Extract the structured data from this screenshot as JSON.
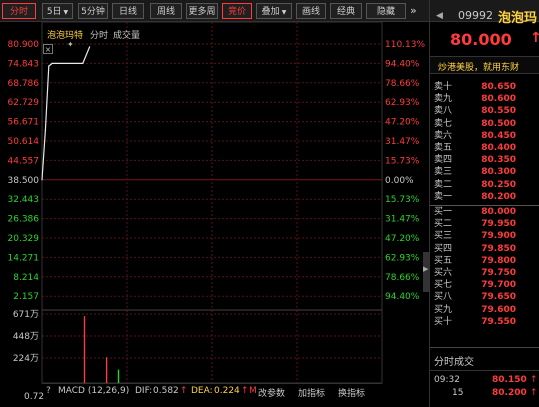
{
  "toolbar": {
    "items": [
      {
        "label": "分时",
        "active": true,
        "has_caret": false
      },
      {
        "label": "5日",
        "active": false,
        "has_caret": true
      },
      {
        "label": "5分钟",
        "active": false,
        "has_caret": false
      },
      {
        "label": "日线",
        "active": false,
        "has_caret": false
      },
      {
        "label": "周线",
        "active": false,
        "has_caret": false
      },
      {
        "label": "更多周",
        "active": false,
        "has_caret": false
      },
      {
        "label": "竞价",
        "active": true,
        "has_caret": false
      },
      {
        "label": "叠加",
        "active": false,
        "has_caret": true
      },
      {
        "label": "画线",
        "active": false,
        "has_caret": false
      },
      {
        "label": "经典",
        "active": false,
        "has_caret": false
      },
      {
        "label": "隐藏",
        "active": false,
        "has_caret": false
      }
    ],
    "more_glyph": "»"
  },
  "stock": {
    "back_glyph": "◀",
    "code": "09992",
    "name": "泡泡玛",
    "price": "80.000",
    "banner": "炒港美股，就用东财"
  },
  "chart_data": {
    "type": "line",
    "title": "泡泡玛特",
    "tabs": [
      "分时",
      "成交量"
    ],
    "y_left_ticks": [
      "80.900",
      "74.843",
      "68.786",
      "62.729",
      "56.671",
      "50.614",
      "44.557",
      "38.500",
      "32.443",
      "26.386",
      "20.329",
      "14.271",
      "8.214",
      "2.157"
    ],
    "y_right_ticks": [
      "110.13%",
      "94.40%",
      "78.66%",
      "62.93%",
      "47.20%",
      "31.47%",
      "15.73%",
      "0.00%",
      "15.73%",
      "31.47%",
      "47.20%",
      "62.93%",
      "78.66%",
      "94.40%"
    ],
    "prev_close": 38.5,
    "ylim": [
      2.157,
      80.9
    ],
    "price_series": [
      {
        "t": 0.0,
        "price": 38.5
      },
      {
        "t": 0.01,
        "price": 54.0
      },
      {
        "t": 0.02,
        "price": 74.0
      },
      {
        "t": 0.03,
        "price": 74.843
      },
      {
        "t": 0.12,
        "price": 74.843
      },
      {
        "t": 0.14,
        "price": 80.0
      }
    ],
    "volume_ticks": [
      "671万",
      "448万",
      "224万"
    ],
    "volume_bars": [
      {
        "t": 0.125,
        "value": 650,
        "color": "#ff3b3b"
      },
      {
        "t": 0.19,
        "value": 250,
        "color": "#ff3b3b"
      },
      {
        "t": 0.225,
        "value": 130,
        "color": "#2ad52a"
      }
    ],
    "volume_max": 671,
    "indicator": {
      "name": "MACD (12,26,9)",
      "dif_label": "DIF:",
      "dif": "0.582",
      "dif_arrow": "↑",
      "dea_label": "DEA:",
      "dea": "0.224",
      "dea_arrow": "↑",
      "m_label": "M",
      "params_label": "改参数",
      "add_label": "加指标",
      "switch_label": "换指标"
    },
    "macd_tick": "0.72",
    "colors": {
      "up": "#ff3b3b",
      "down": "#2ad52a",
      "flat": "#c8c8c8",
      "price_line": "#e8e8e8",
      "grid": "#5a1212"
    }
  },
  "order_book": {
    "asks": [
      {
        "label": "卖十",
        "price": "80.650"
      },
      {
        "label": "卖九",
        "price": "80.600"
      },
      {
        "label": "卖八",
        "price": "80.550"
      },
      {
        "label": "卖七",
        "price": "80.500"
      },
      {
        "label": "卖六",
        "price": "80.450"
      },
      {
        "label": "卖五",
        "price": "80.400"
      },
      {
        "label": "卖四",
        "price": "80.350"
      },
      {
        "label": "卖三",
        "price": "80.300"
      },
      {
        "label": "卖二",
        "price": "80.250"
      },
      {
        "label": "卖一",
        "price": "80.200"
      }
    ],
    "bids": [
      {
        "label": "买一",
        "price": "80.000"
      },
      {
        "label": "买二",
        "price": "79.950"
      },
      {
        "label": "买三",
        "price": "79.900"
      },
      {
        "label": "买四",
        "price": "79.850"
      },
      {
        "label": "买五",
        "price": "79.800"
      },
      {
        "label": "买六",
        "price": "79.750"
      },
      {
        "label": "买七",
        "price": "79.700"
      },
      {
        "label": "买八",
        "price": "79.650"
      },
      {
        "label": "买九",
        "price": "79.600"
      },
      {
        "label": "买十",
        "price": "79.550"
      }
    ],
    "price_color": "#ff3b3b"
  },
  "ticks_panel": {
    "title": "分时成交",
    "rows": [
      {
        "time": "09:32",
        "price": "80.150",
        "arrow": "↑"
      },
      {
        "time": "15",
        "price": "80.200",
        "arrow": "↑"
      }
    ]
  }
}
